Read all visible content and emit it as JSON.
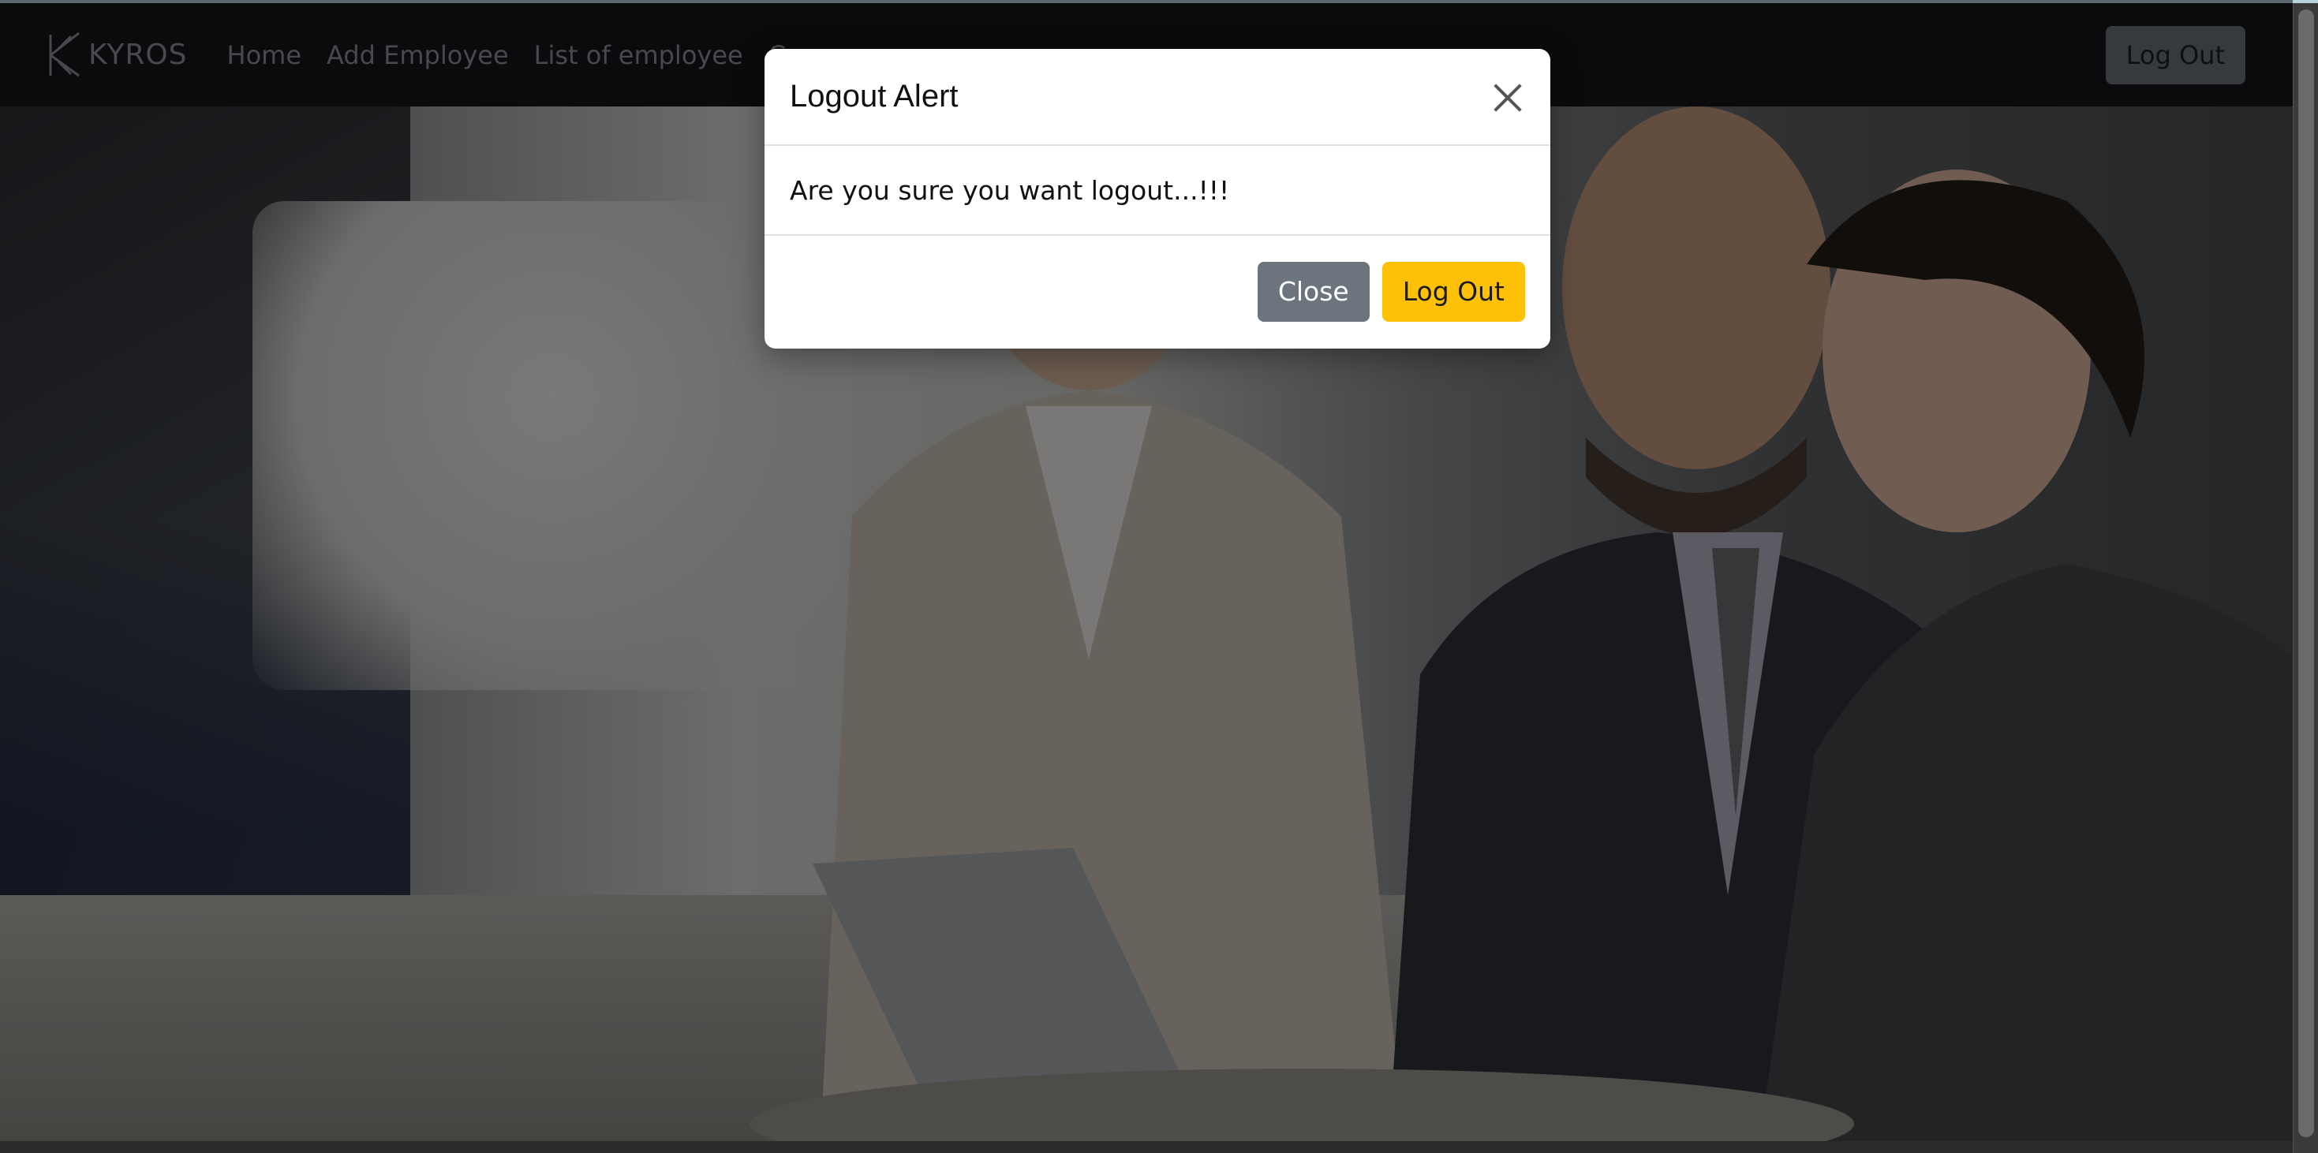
{
  "navbar": {
    "brand": "KYROS",
    "links": [
      "Home",
      "Add Employee",
      "List of employee",
      "Cona"
    ],
    "logout_label": "Log Out"
  },
  "modal": {
    "title": "Logout Alert",
    "message": "Are you sure you want logout...!!!",
    "close_label": "Close",
    "logout_label": "Log Out"
  },
  "colors": {
    "navbar_bg": "#16171a",
    "secondary_button": "#6c757d",
    "warning_button": "#ffc107"
  }
}
